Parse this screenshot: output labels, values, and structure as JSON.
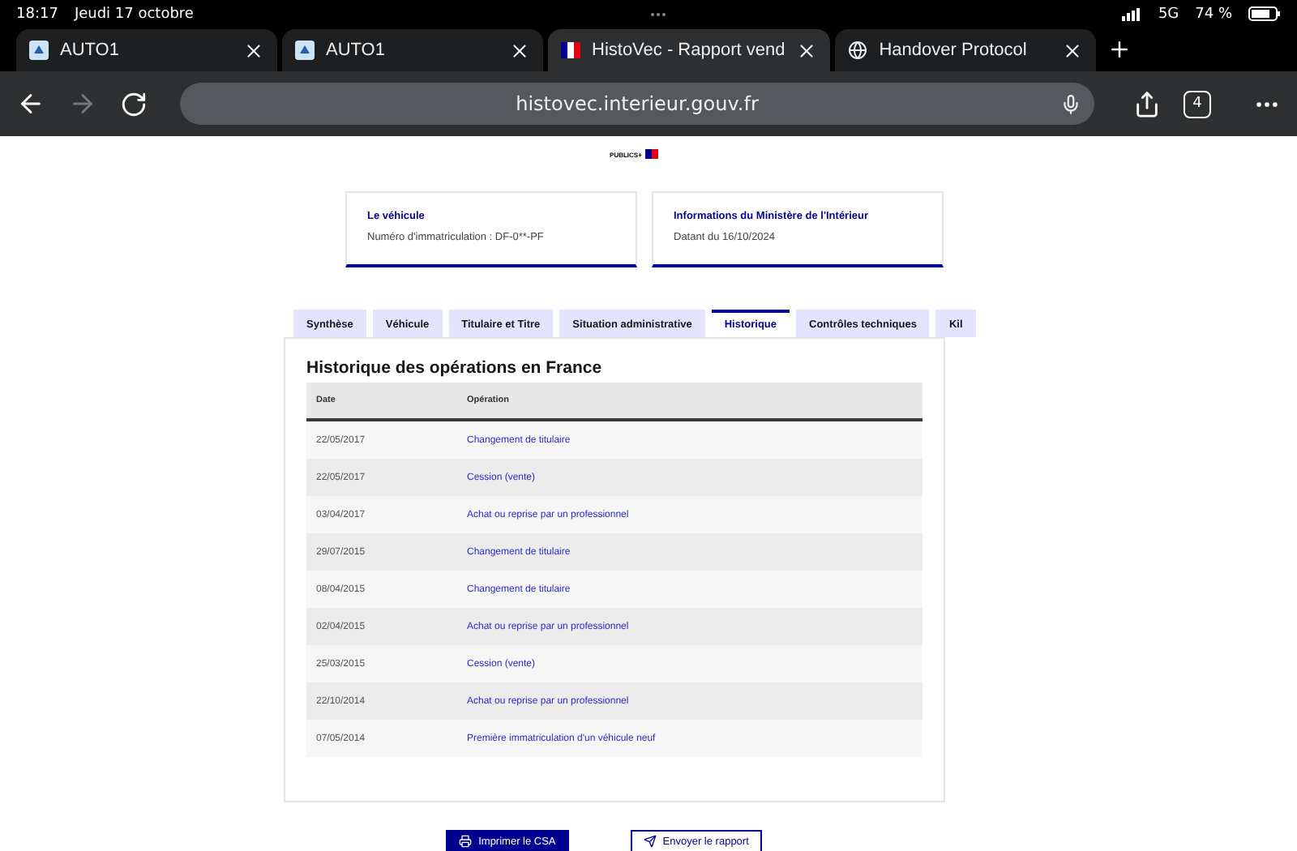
{
  "status_bar": {
    "time": "18:17",
    "date": "Jeudi 17 octobre",
    "network": "5G",
    "battery": "74 %"
  },
  "browser_tabs": [
    {
      "title": "AUTO1",
      "selected": false
    },
    {
      "title": "AUTO1",
      "selected": false
    },
    {
      "title": "HistoVec - Rapport vend",
      "selected": true
    },
    {
      "title": "Handover Protocol",
      "selected": false
    }
  ],
  "address_bar": {
    "url": "histovec.interieur.gouv.fr"
  },
  "tab_count": "4",
  "logo_text": "PUBLICS+",
  "cards": [
    {
      "title": "Le véhicule",
      "text": "Numéro d'immatriculation : DF-0**-PF"
    },
    {
      "title": "Informations du Ministère de l'Intérieur",
      "text": "Datant du 16/10/2024"
    }
  ],
  "tabs": [
    {
      "label": "Synthèse",
      "selected": false
    },
    {
      "label": "Véhicule",
      "selected": false
    },
    {
      "label": "Titulaire et Titre",
      "selected": false
    },
    {
      "label": "Situation administrative",
      "selected": false
    },
    {
      "label": "Historique",
      "selected": true
    },
    {
      "label": "Contrôles techniques",
      "selected": false
    },
    {
      "label": "Kil",
      "selected": false
    }
  ],
  "section_title": "Historique des opérations en France",
  "table": {
    "columns": [
      "Date",
      "Opération"
    ],
    "rows": [
      {
        "date": "22/05/2017",
        "operation": "Changement de titulaire"
      },
      {
        "date": "22/05/2017",
        "operation": "Cession (vente)"
      },
      {
        "date": "03/04/2017",
        "operation": "Achat ou reprise par un professionnel"
      },
      {
        "date": "29/07/2015",
        "operation": "Changement de titulaire"
      },
      {
        "date": "08/04/2015",
        "operation": "Changement de titulaire"
      },
      {
        "date": "02/04/2015",
        "operation": "Achat ou reprise par un professionnel"
      },
      {
        "date": "25/03/2015",
        "operation": "Cession (vente)"
      },
      {
        "date": "22/10/2014",
        "operation": "Achat ou reprise par un professionnel"
      },
      {
        "date": "07/05/2014",
        "operation": "Première immatriculation d'un véhicule neuf"
      }
    ]
  },
  "buttons": [
    {
      "label": "Imprimer le CSA",
      "kind": "primary"
    },
    {
      "label": "Envoyer le rapport",
      "kind": "secondary"
    }
  ]
}
